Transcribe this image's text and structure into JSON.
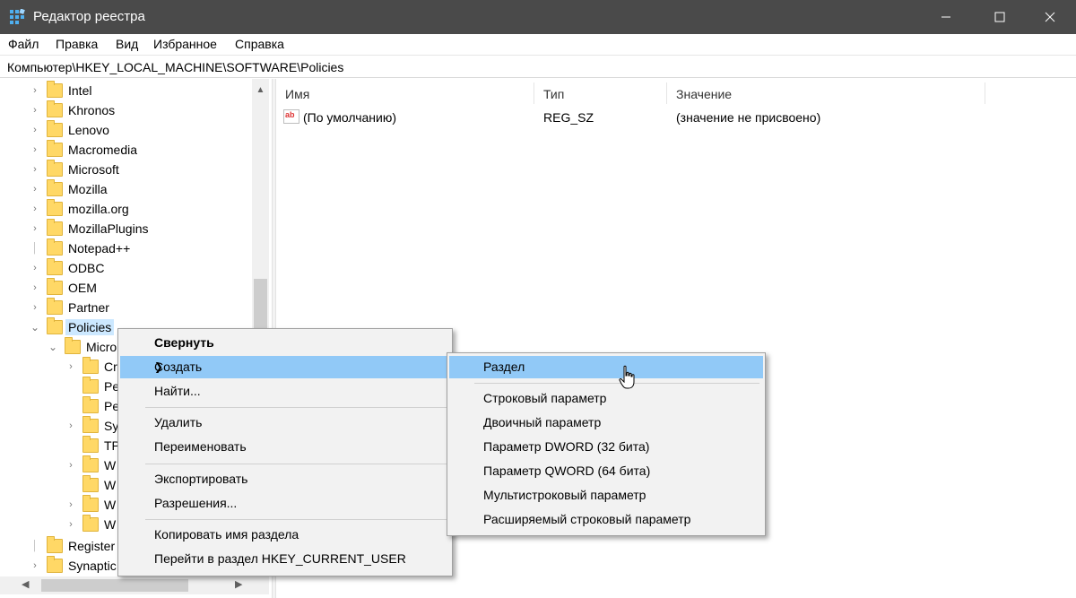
{
  "window": {
    "title": "Редактор реестра",
    "icon": "registry-editor-icon",
    "controls": {
      "minimize": "minimize-icon",
      "maximize": "maximize-icon",
      "close": "close-icon"
    }
  },
  "menubar": [
    "Файл",
    "Правка",
    "Вид",
    "Избранное",
    "Справка"
  ],
  "address": "Компьютер\\HKEY_LOCAL_MACHINE\\SOFTWARE\\Policies",
  "tree": {
    "items": [
      {
        "label": "Intel"
      },
      {
        "label": "Khronos"
      },
      {
        "label": "Lenovo"
      },
      {
        "label": "Macromedia"
      },
      {
        "label": "Microsoft"
      },
      {
        "label": "Mozilla"
      },
      {
        "label": "mozilla.org"
      },
      {
        "label": "MozillaPlugins"
      },
      {
        "label": "Notepad++"
      },
      {
        "label": "ODBC"
      },
      {
        "label": "OEM"
      },
      {
        "label": "Partner"
      },
      {
        "label": "Policies"
      },
      {
        "label": "Micro"
      },
      {
        "label": "Cr"
      },
      {
        "label": "Pe"
      },
      {
        "label": "Pe"
      },
      {
        "label": "Sy"
      },
      {
        "label": "TP"
      },
      {
        "label": "W"
      },
      {
        "label": "W"
      },
      {
        "label": "W"
      },
      {
        "label": "W"
      },
      {
        "label": "Register"
      },
      {
        "label": "Synaptic"
      }
    ]
  },
  "list": {
    "columns": [
      "Имя",
      "Тип",
      "Значение"
    ],
    "rows": [
      {
        "name": "(По умолчанию)",
        "type": "REG_SZ",
        "value": "(значение не присвоено)"
      }
    ]
  },
  "context_menu": {
    "items": {
      "collapse": "Свернуть",
      "create": "Создать",
      "find": "Найти...",
      "delete": "Удалить",
      "rename": "Переименовать",
      "export": "Экспортировать",
      "permissions": "Разрешения...",
      "copy_key_name": "Копировать имя раздела",
      "goto_hkcu": "Перейти в раздел HKEY_CURRENT_USER"
    }
  },
  "submenu": {
    "items": {
      "key": "Раздел",
      "string": "Строковый параметр",
      "binary": "Двоичный параметр",
      "dword": "Параметр DWORD (32 бита)",
      "qword": "Параметр QWORD (64 бита)",
      "multi_string": "Мультистроковый параметр",
      "expandable_string": "Расширяемый строковый параметр"
    }
  },
  "colors": {
    "titlebar": "#4a4a4a",
    "menu_highlight": "#91c9f7",
    "tree_selected": "#cce8ff",
    "folder": "#ffd866"
  }
}
